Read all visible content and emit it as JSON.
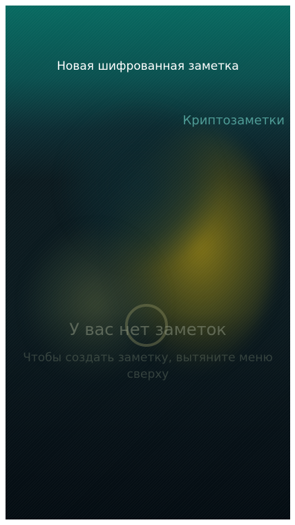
{
  "menu": {
    "new_encrypted_note": "Новая шифрованная заметка"
  },
  "app": {
    "title": "Криптозаметки"
  },
  "empty_state": {
    "title": "У вас нет заметок",
    "hint": "Чтобы создать заметку, вытяните меню сверху"
  },
  "colors": {
    "accent_teal": "#0a6e64",
    "highlight_yellow": "#96821a",
    "background_dark": "#0b1a1f"
  }
}
